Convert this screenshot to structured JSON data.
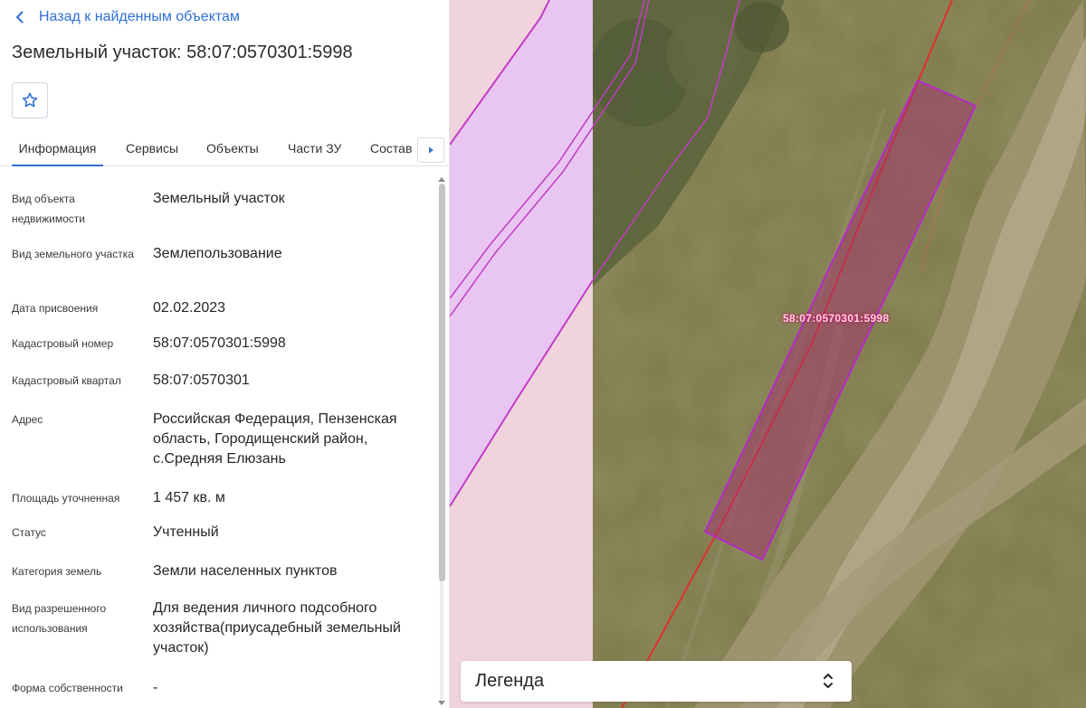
{
  "header": {
    "back_label": "Назад к найденным объектам",
    "title": "Земельный участок: 58:07:0570301:5998"
  },
  "tabs": [
    {
      "label": "Информация",
      "active": true
    },
    {
      "label": "Сервисы",
      "active": false
    },
    {
      "label": "Объекты",
      "active": false
    },
    {
      "label": "Части ЗУ",
      "active": false
    },
    {
      "label": "Состав",
      "active": false
    }
  ],
  "properties": [
    {
      "label": "Вид объекта недвижимости",
      "value": "Земельный участок"
    },
    {
      "label": "Вид земельного участка",
      "value": "Землепользование"
    },
    {
      "label": "Дата присвоения",
      "value": "02.02.2023"
    },
    {
      "label": "Кадастровый номер",
      "value": "58:07:0570301:5998"
    },
    {
      "label": "Кадастровый квартал",
      "value": "58:07:0570301"
    },
    {
      "label": "Адрес",
      "value": "Российская Федерация, Пензенская область, Городищенский район, с.Средняя Елюзань"
    },
    {
      "label": "Площадь уточненная",
      "value": "1 457 кв. м"
    },
    {
      "label": "Статус",
      "value": "Учтенный"
    },
    {
      "label": "Категория земель",
      "value": "Земли населенных пунктов"
    },
    {
      "label": "Вид разрешенного использования",
      "value": "Для ведения личного подсобного хозяйства(приусадебный земельный участок)"
    },
    {
      "label": "Форма собственности",
      "value": "-"
    }
  ],
  "map": {
    "parcel_label": "58:07:0570301:5998",
    "legend_label": "Легенда"
  },
  "icons": {
    "back": "chevron-left-icon",
    "favorite": "star-outline-icon",
    "tabs_next": "caret-right-icon",
    "legend_toggle": "chevron-up-down-icon"
  },
  "colors": {
    "accent": "#2f6fd6",
    "parcel_fill": "#a3306e",
    "parcel_border": "#b52ac8",
    "boundary_red": "#e0302c",
    "zone_pink": "#f0d3dc",
    "zone_lilac": "#e9c6f2"
  }
}
